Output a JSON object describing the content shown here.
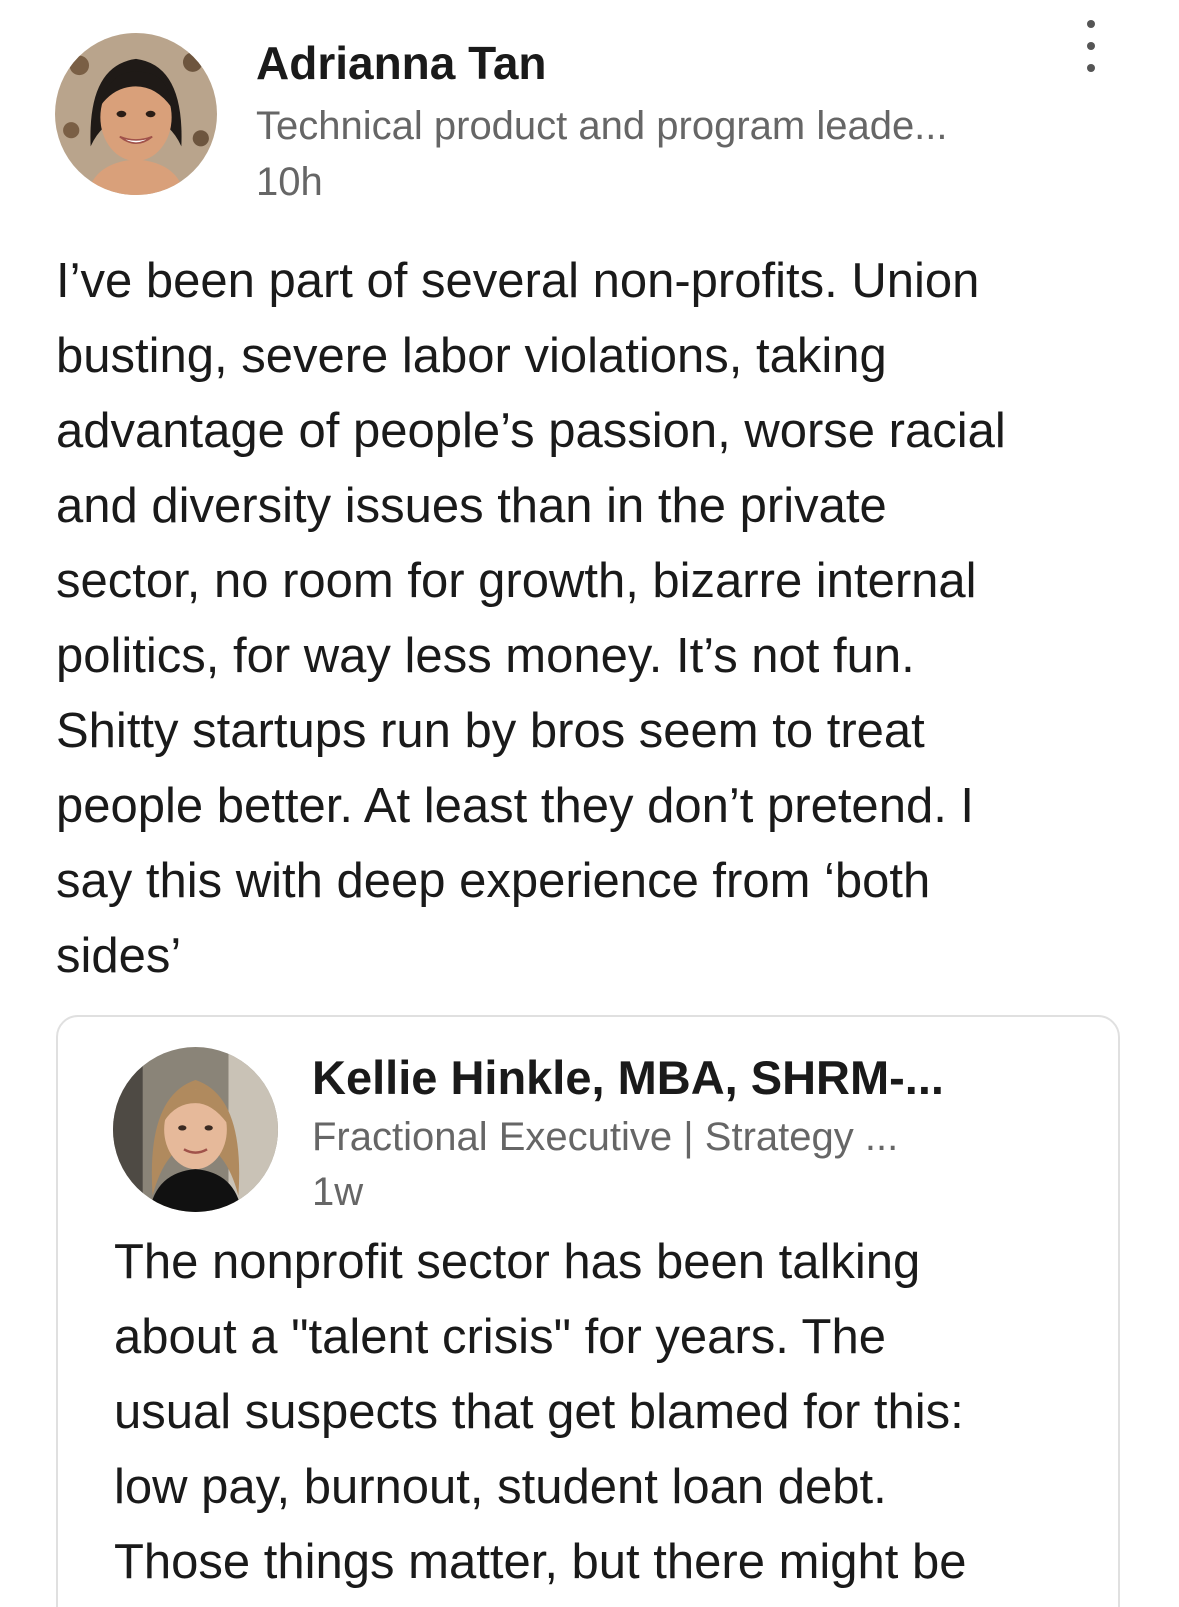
{
  "post": {
    "author": {
      "name": "Adrianna Tan",
      "headline": "Technical product and program leade...",
      "time": "10h"
    },
    "body_lines": [
      "I’ve been part of several non-profits. Union",
      "busting, severe labor violations, taking",
      "advantage of people’s passion, worse racial",
      "and diversity issues than in the private",
      "sector, no room for growth, bizarre internal",
      "politics, for way less money. It’s not fun.",
      "Shitty startups run by bros seem to treat",
      "people better. At least they don’t pretend. I",
      "say this with deep experience from ‘both",
      "sides’"
    ],
    "icons": {
      "more": "more-vertical-icon"
    }
  },
  "reshared": {
    "author": {
      "name": "Kellie Hinkle, MBA, SHRM-...",
      "headline": "Fractional Executive | Strategy ...",
      "time": "1w"
    },
    "body_lines": [
      "The nonprofit sector has been talking",
      "about a \"talent crisis\" for years. The",
      "usual suspects that get blamed for this:",
      "low pay, burnout, student loan debt.",
      "Those things matter, but there might be"
    ]
  },
  "colors": {
    "text_primary": "#1a1a1a",
    "text_secondary": "#666666",
    "card_border": "#e0e0e0"
  }
}
